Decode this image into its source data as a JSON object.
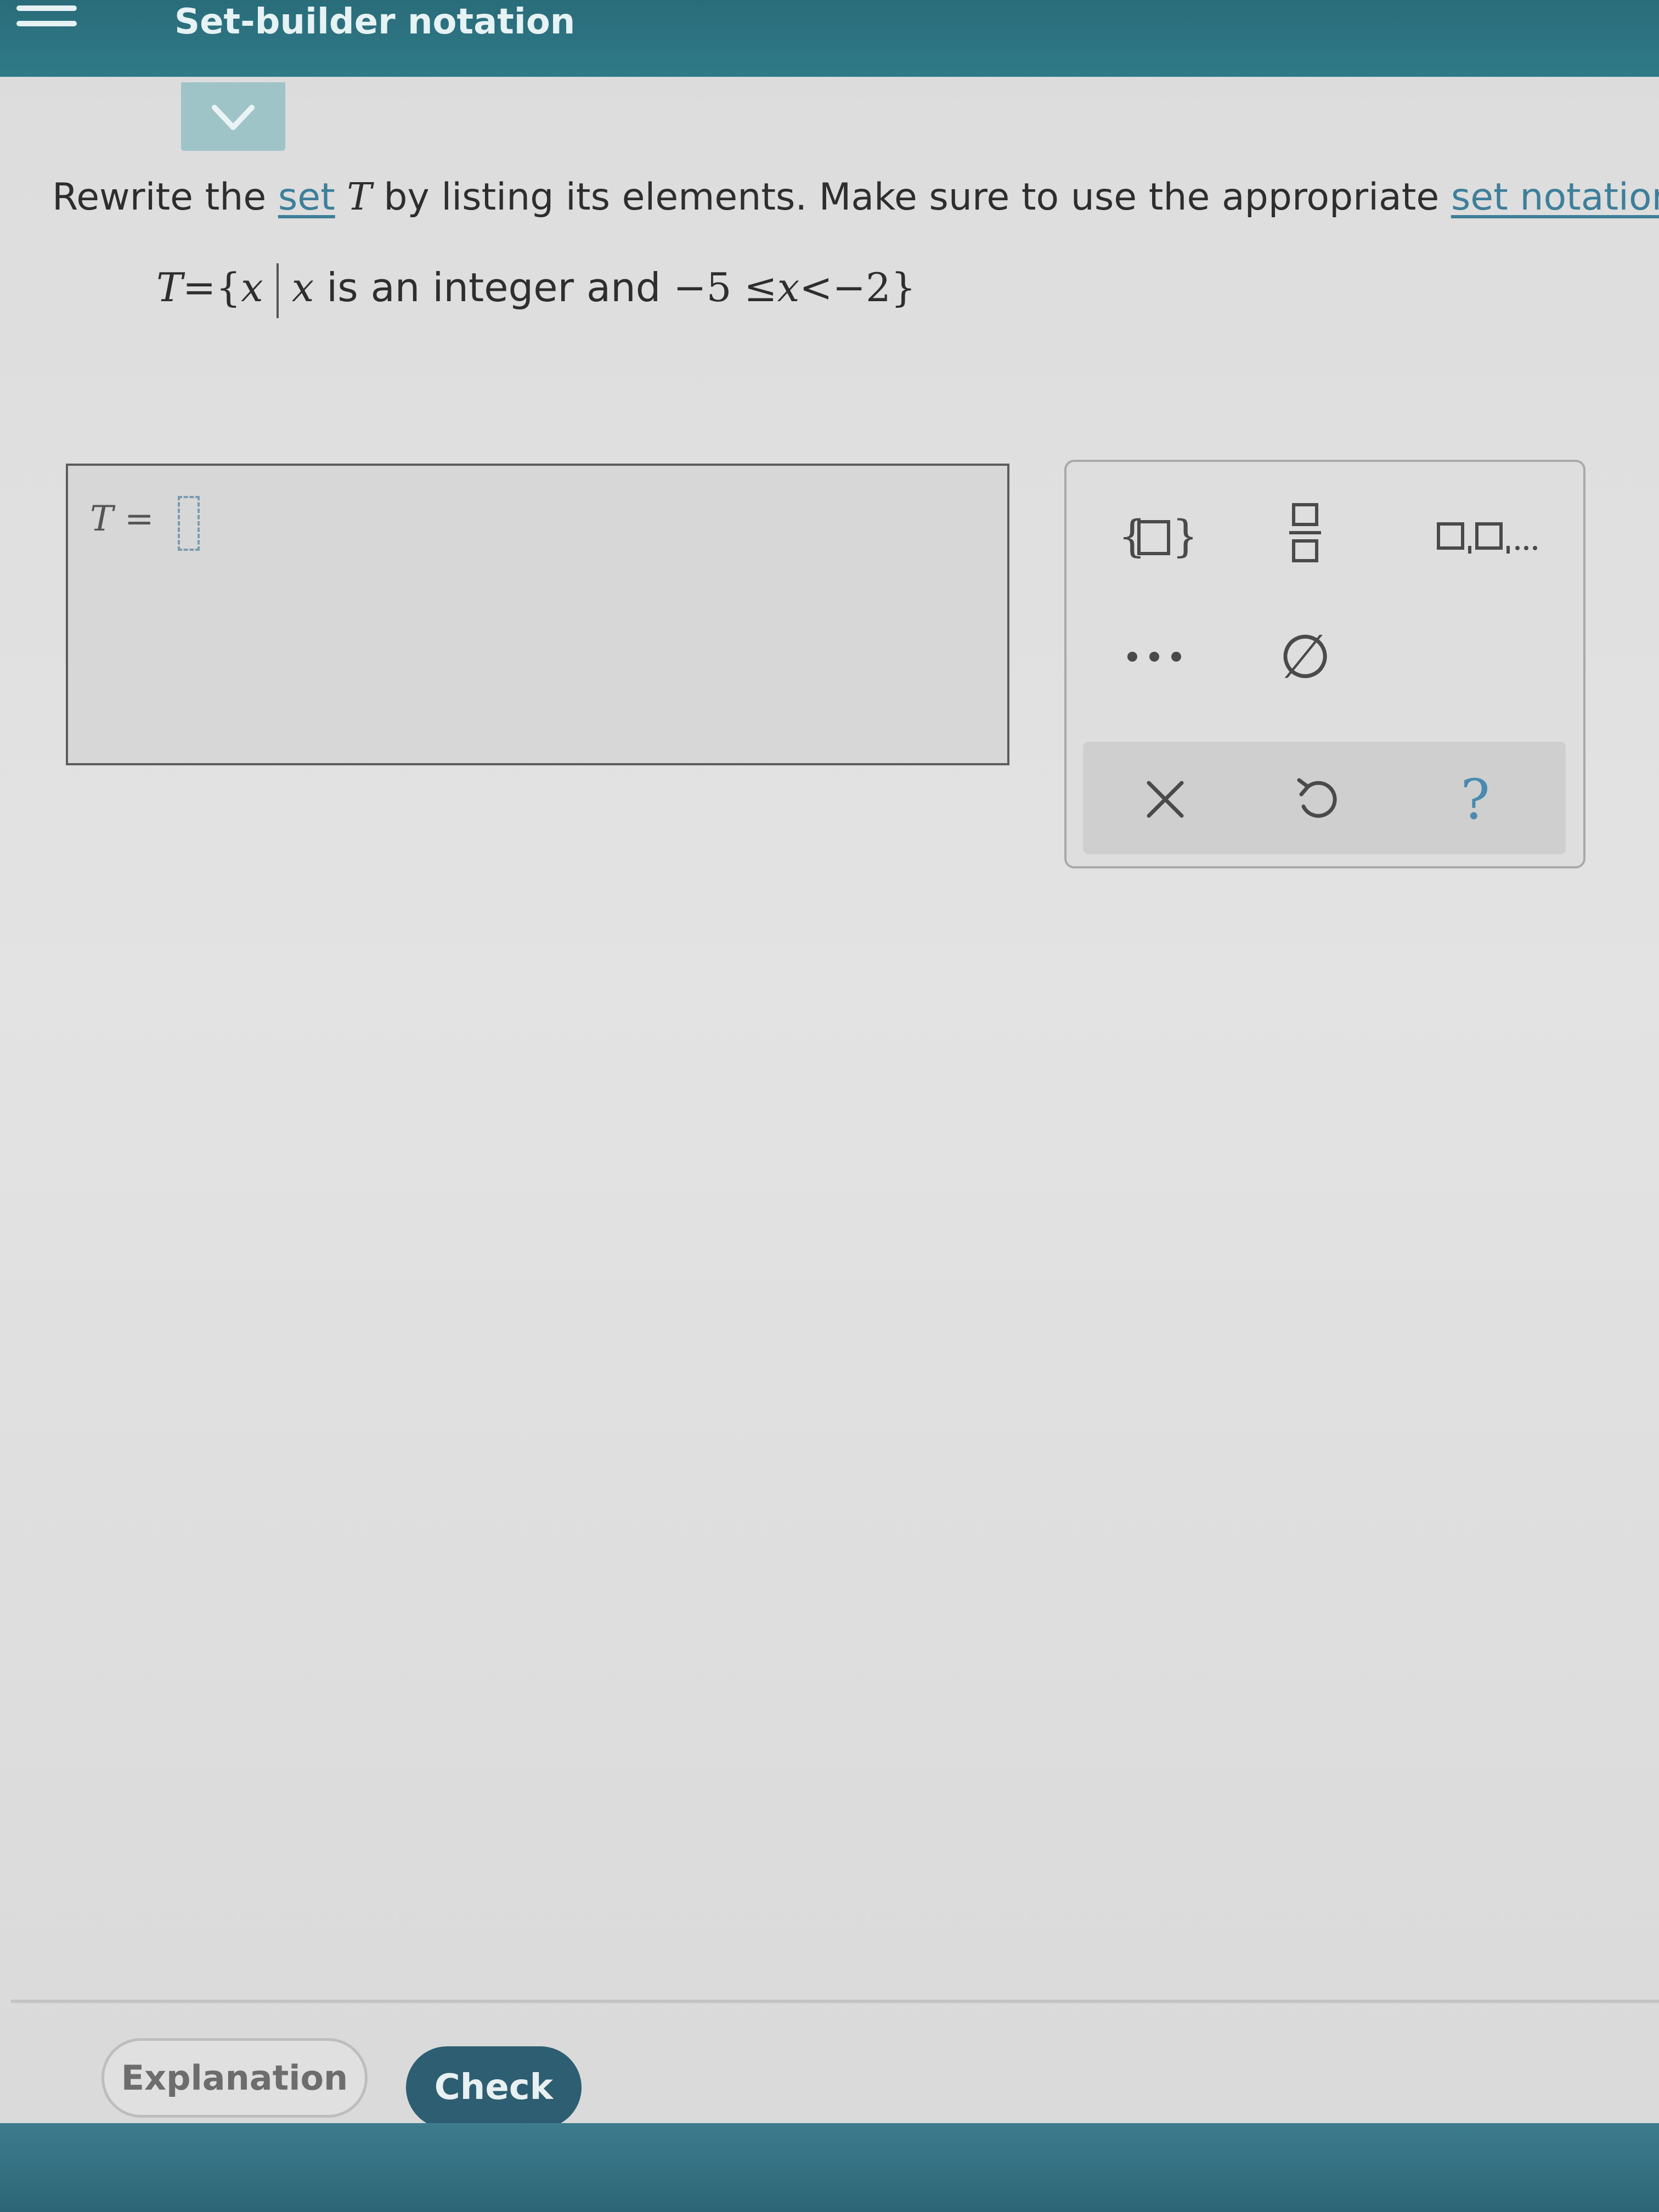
{
  "header": {
    "title": "Set-builder notation"
  },
  "prompt": {
    "text_before": "Rewrite the ",
    "set_link": "set",
    "set_name": "T",
    "text_middle": " by listing its elements. Make sure to use the appropriate ",
    "notation_link": "set notation"
  },
  "set_definition": {
    "lhs": "T",
    "eq": "=",
    "open": "{",
    "var": "x",
    "var2": "x",
    "condition": " is an integer and ",
    "lower": "−5",
    "le": "≤",
    "var3": "x",
    "lt": "<",
    "upper": "−2",
    "close": "}"
  },
  "answer": {
    "label_var": "T",
    "label_eq": " ="
  },
  "keypad": {
    "set_braces_key": "{□}",
    "fraction_key": "□/□",
    "list_key": "□,□,...",
    "ellipsis_key": "...",
    "empty_set_key": "∅",
    "clear_key": "×",
    "undo_key": "↺",
    "help_key": "?"
  },
  "buttons": {
    "explanation": "Explanation",
    "check": "Check"
  }
}
